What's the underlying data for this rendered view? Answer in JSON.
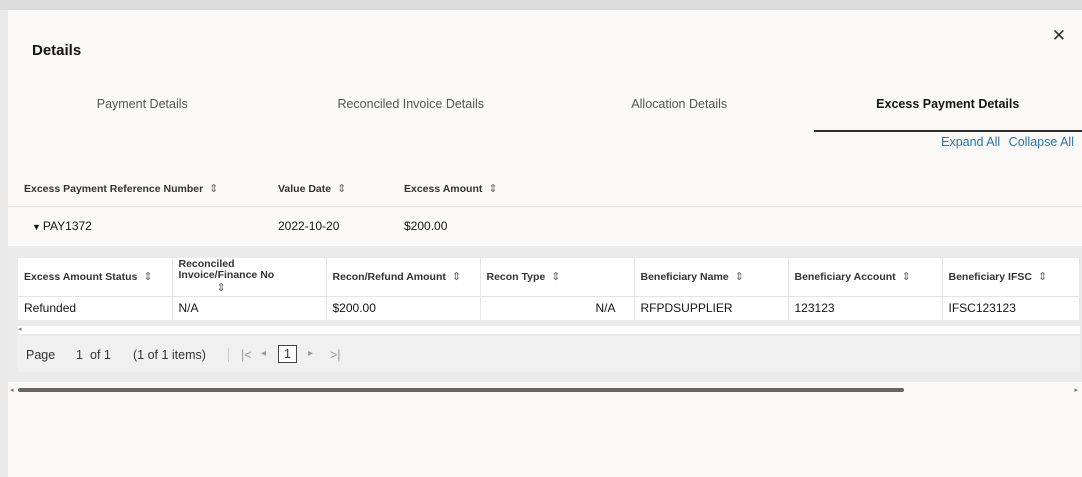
{
  "dialog": {
    "title": "Details",
    "close_glyph": "✕"
  },
  "tabs": [
    {
      "label": "Payment Details",
      "active": false
    },
    {
      "label": "Reconciled Invoice Details",
      "active": false
    },
    {
      "label": "Allocation Details",
      "active": false
    },
    {
      "label": "Excess Payment Details",
      "active": true
    }
  ],
  "links": {
    "expand_all": "Expand All",
    "collapse_all": "Collapse All"
  },
  "outer_table": {
    "headers": [
      "Excess Payment Reference Number",
      "Value Date",
      "Excess Amount"
    ],
    "row": {
      "ref": "PAY1372",
      "value_date": "2022-10-20",
      "excess_amount": "$200.00"
    }
  },
  "inner_table": {
    "headers": [
      "Excess Amount Status",
      "Reconciled Invoice/Finance No",
      "Recon/Refund Amount",
      "Recon Type",
      "Beneficiary Name",
      "Beneficiary Account",
      "Beneficiary IFSC"
    ],
    "header2_lines": [
      "Reconciled",
      "Invoice/Finance No"
    ],
    "row": [
      "Refunded",
      "N/A",
      "$200.00",
      "N/A",
      "RFPDSUPPLIER",
      "123123",
      "IFSC123123"
    ]
  },
  "pager": {
    "page_label": "Page",
    "page": "1",
    "of": "of 1",
    "items": "(1 of 1 items)",
    "first_glyph": "|<",
    "prev_glyph": "◂",
    "current": "1",
    "next_glyph": "▸",
    "last_glyph": ">|"
  },
  "icons": {
    "sort": "⇕",
    "caret_down": "▼",
    "scroll_left": "◂",
    "scroll_right": "▸"
  },
  "colors": {
    "link": "#2d72a5",
    "active_tab_underline": "#2b2b2b",
    "scrollbar_thumb": "#666666"
  }
}
